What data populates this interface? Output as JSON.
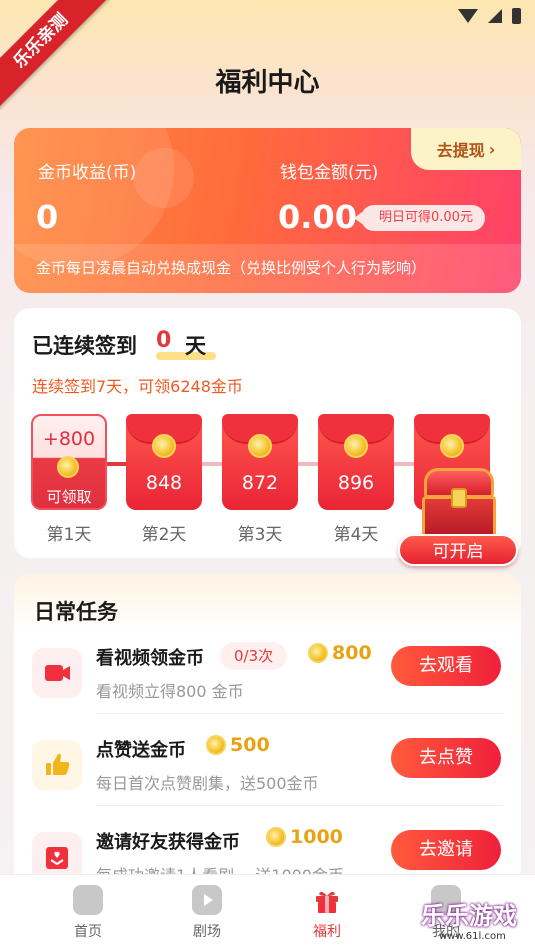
{
  "ribbon": "乐乐亲测",
  "page_title": "福利中心",
  "coin_card": {
    "withdraw_label": "去提现",
    "coin_income_label": "金币收益(币)",
    "coin_income_value": "0",
    "wallet_label": "钱包金额(元)",
    "wallet_value": "0.00",
    "tomorrow_badge": "明日可得0.00元",
    "note": "金币每日凌晨自动兑换成现金（兑换比例受个人行为影响）"
  },
  "checkin": {
    "title": "已连续签到",
    "days": "0",
    "unit": "天",
    "subtitle": "连续签到7天，可领6248金币",
    "first": {
      "plus": "+800",
      "claim": "可领取"
    },
    "envelopes": [
      "848",
      "872",
      "896"
    ],
    "day_labels": [
      "第1天",
      "第2天",
      "第3天",
      "第4天"
    ],
    "open_label": "可开启"
  },
  "tasks": {
    "title": "日常任务",
    "items": [
      {
        "name": "看视频领金币",
        "count": "0/3次",
        "reward": "800",
        "desc": "看视频立得800 金币",
        "button": "去观看",
        "icon": "video-icon"
      },
      {
        "name": "点赞送金币",
        "reward": "500",
        "desc": "每日首次点赞剧集，送500金币",
        "button": "去点赞",
        "icon": "thumbs-up-icon"
      },
      {
        "name": "邀请好友获得金币",
        "reward": "1000",
        "desc": "每成功邀请1人看剧， 送1000金币",
        "button": "去邀请",
        "icon": "invite-icon"
      }
    ]
  },
  "nav": {
    "items": [
      {
        "label": "首页"
      },
      {
        "label": "剧场"
      },
      {
        "label": "福利"
      },
      {
        "label": "我的"
      }
    ],
    "active": "福利"
  },
  "watermark": {
    "text": "乐乐游戏",
    "url": "www.61l.com"
  },
  "colors": {
    "accent": "#e4393c",
    "card_orange": "#ff6a3d",
    "gold": "#e8a214"
  }
}
